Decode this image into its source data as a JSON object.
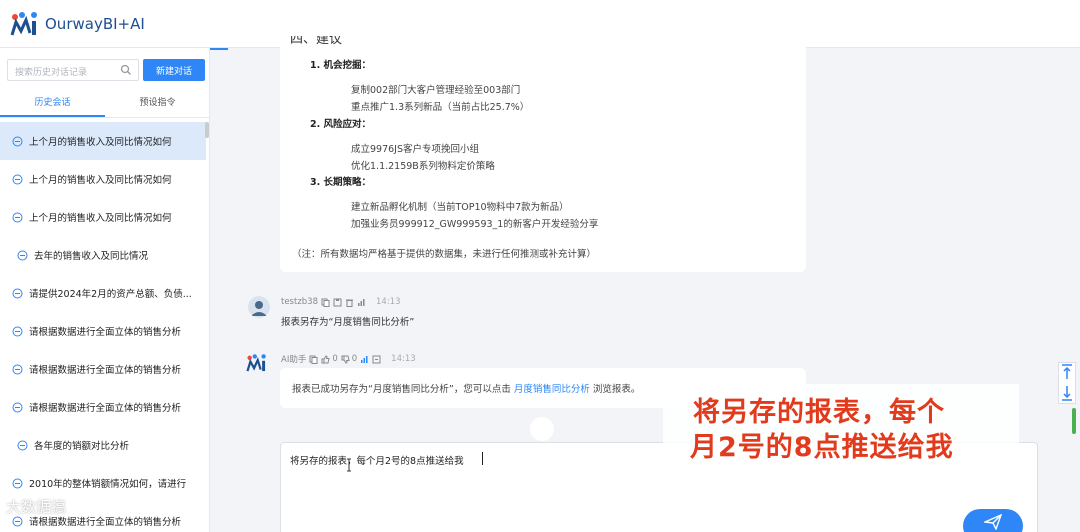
{
  "app": {
    "title": "OurwayBI+AI"
  },
  "sidebar": {
    "search_placeholder": "搜索历史对话记录",
    "new_chat_label": "新建对话",
    "tabs": [
      {
        "label": "历史会话",
        "active": true
      },
      {
        "label": "预设指令",
        "active": false
      }
    ],
    "history": [
      {
        "label": "上个月的销售收入及同比情况如何",
        "active": true
      },
      {
        "label": "上个月的销售收入及同比情况如何"
      },
      {
        "label": "上个月的销售收入及同比情况如何"
      },
      {
        "label": "去年的销售收入及同比情况"
      },
      {
        "label": "请提供2024年2月的资产总额、负债..."
      },
      {
        "label": "请根据数据进行全面立体的销售分析"
      },
      {
        "label": "请根据数据进行全面立体的销售分析"
      },
      {
        "label": "请根据数据进行全面立体的销售分析"
      },
      {
        "label": "各年度的销额对比分析"
      },
      {
        "label": "2010年的整体销额情况如何，请进行"
      },
      {
        "label": "请根据数据进行全面立体的销售分析"
      }
    ]
  },
  "report": {
    "heading_partial": "四、建议",
    "sections": [
      {
        "title": "1. 机会挖掘：",
        "lines": [
          "复制002部门大客户管理经验至003部门",
          "重点推广1.3系列新品（当前占比25.7%）"
        ]
      },
      {
        "title": "2. 风险应对：",
        "lines": [
          "成立9976JS客户专项挽回小组",
          "优化1.1.2159B系列物料定价策略"
        ]
      },
      {
        "title": "3. 长期策略：",
        "lines": [
          "建立新品孵化机制（当前TOP10物料中7款为新品）",
          "加强业务员999912_GW999593_1的新客户开发经验分享"
        ]
      }
    ],
    "note": "（注：所有数据均严格基于提供的数据集，未进行任何推测或补充计算）"
  },
  "user_message": {
    "name": "testzb38",
    "time": "14:13",
    "text": "报表另存为“月度销售同比分析”"
  },
  "ai_message": {
    "name": "AI助手",
    "like_count": "0",
    "dislike_count": "0",
    "time": "14:13",
    "text_before": "报表已成功另存为“月度销售同比分析”，您可以点击 ",
    "link": "月度销售同比分析",
    "text_after": " 浏览报表。"
  },
  "input": {
    "value": "将另存的报表，每个月2号的8点推送给我"
  },
  "overlay": {
    "line1": "将另存的报表，每个",
    "line2": "月2号的8点推送给我"
  },
  "watermark": "大数据搞"
}
